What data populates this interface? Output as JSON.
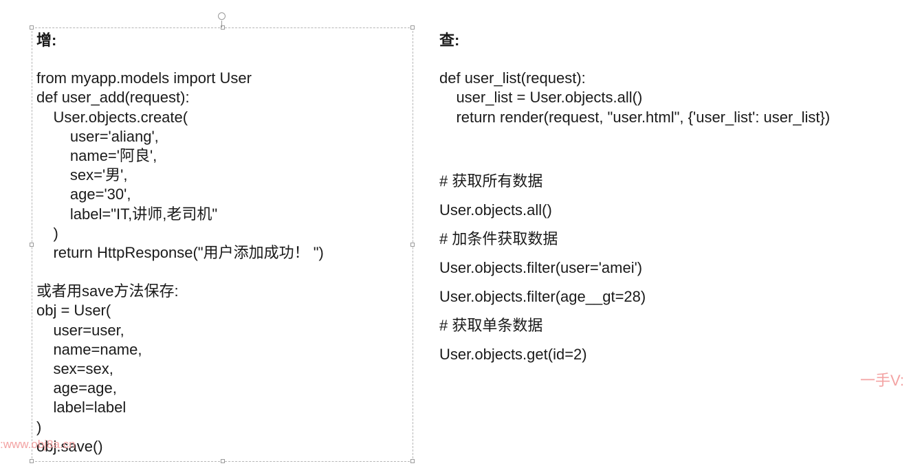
{
  "left": {
    "heading": "增:",
    "lines": [
      "",
      "from myapp.models import User",
      "def user_add(request):",
      "    User.objects.create(",
      "        user='aliang',",
      "        name='阿良',",
      "        sex='男',",
      "        age='30',",
      "        label=\"IT,讲师,老司机\"",
      "    )",
      "    return HttpResponse(\"用户添加成功！ \")",
      "",
      "或者用save方法保存:",
      "obj = User(",
      "    user=user,",
      "    name=name,",
      "    sex=sex,",
      "    age=age,",
      "    label=label",
      ")",
      "obj.save()"
    ]
  },
  "right": {
    "heading": "查:",
    "code_lines": [
      "",
      "def user_list(request):",
      "    user_list = User.objects.all()",
      "    return render(request, \"user.html\", {'user_list': user_list})"
    ],
    "query_lines": [
      "# 获取所有数据",
      "User.objects.all()",
      "# 加条件获取数据",
      "User.objects.filter(user='amei')",
      "User.objects.filter(age__gt=28)",
      "# 获取单条数据",
      "User.objects.get(id=2)"
    ]
  },
  "watermarks": {
    "left": ":www.obj8a.cn",
    "right": "一手V:"
  }
}
